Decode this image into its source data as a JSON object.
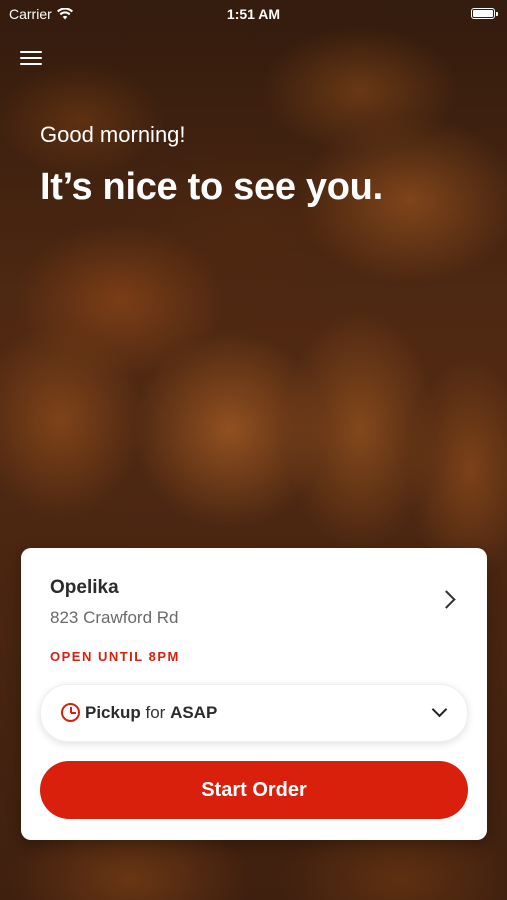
{
  "status_bar": {
    "carrier": "Carrier",
    "time": "1:51 AM",
    "icons": [
      "wifi-icon",
      "battery-icon"
    ]
  },
  "header": {
    "menu_icon": "hamburger-menu-icon",
    "greeting": "Good morning!",
    "headline": "It’s nice to see you."
  },
  "store_card": {
    "name": "Opelika",
    "address": "823 Crawford Rd",
    "status": "OPEN UNTIL 8PM",
    "pickup": {
      "mode": "Pickup",
      "connector": "for",
      "time": "ASAP"
    },
    "start_label": "Start Order"
  },
  "colors": {
    "accent": "#d8200d",
    "card_bg": "#ffffff",
    "text_primary": "#2b2b2b",
    "text_secondary": "#6a6a6a"
  }
}
